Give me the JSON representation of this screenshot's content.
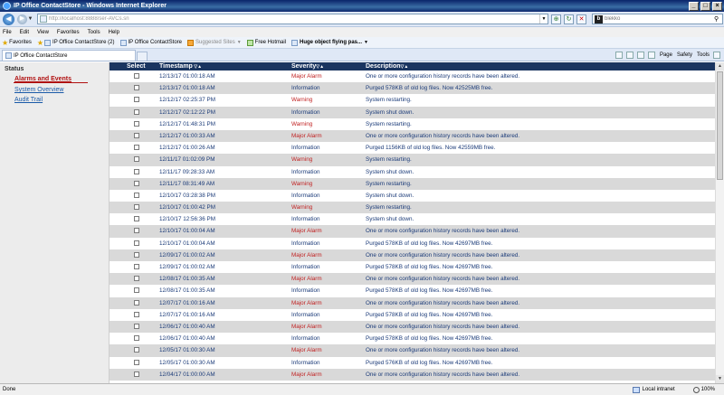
{
  "window": {
    "title": "IP Office ContactStore - Windows Internet Explorer"
  },
  "address": {
    "url": "http://localhost:8888/ser-AVCs.sn"
  },
  "search": {
    "placeholder": "blekko"
  },
  "menu": [
    "File",
    "Edit",
    "View",
    "Favorites",
    "Tools",
    "Help"
  ],
  "favorites": {
    "label": "Favorites",
    "items": [
      {
        "label": "IP Office ContactStore (2)",
        "icon": "page-icon"
      },
      {
        "label": "IP Office ContactStore",
        "icon": "page-icon"
      },
      {
        "label": "Suggested Sites",
        "icon": "rss-icon",
        "muted": true
      },
      {
        "label": "Free Hotmail",
        "icon": "page-icon"
      },
      {
        "label": "Huge object flying pas...",
        "icon": "page-icon",
        "bold": true
      }
    ]
  },
  "tab": {
    "label": "IP Office ContactStore"
  },
  "commandbar": {
    "page": "Page",
    "safety": "Safety",
    "tools": "Tools"
  },
  "sidebar": {
    "title": "Status",
    "items": [
      {
        "label": "Alarms and Events",
        "active": true
      },
      {
        "label": "System Overview",
        "active": false
      },
      {
        "label": "Audit Trail",
        "active": false
      }
    ]
  },
  "table": {
    "headers": {
      "select": "Select",
      "timestamp": "Timestamp",
      "severity": "Severity",
      "description": "Description"
    },
    "rows": [
      {
        "timestamp": "12/13/17 01:00:18 AM",
        "severity": "Major Alarm",
        "description": "One or more configuration history records have been altered."
      },
      {
        "timestamp": "12/13/17 01:00:18 AM",
        "severity": "Information",
        "description": "Purged 578KB of old log files. Now 42525MB free."
      },
      {
        "timestamp": "12/12/17 02:25:37 PM",
        "severity": "Warning",
        "description": "System restarting."
      },
      {
        "timestamp": "12/12/17 02:12:22 PM",
        "severity": "Information",
        "description": "System shut down."
      },
      {
        "timestamp": "12/12/17 01:48:31 PM",
        "severity": "Warning",
        "description": "System restarting."
      },
      {
        "timestamp": "12/12/17 01:00:33 AM",
        "severity": "Major Alarm",
        "description": "One or more configuration history records have been altered."
      },
      {
        "timestamp": "12/12/17 01:00:26 AM",
        "severity": "Information",
        "description": "Purged 1156KB of old log files. Now 42559MB free."
      },
      {
        "timestamp": "12/11/17 01:02:09 PM",
        "severity": "Warning",
        "description": "System restarting."
      },
      {
        "timestamp": "12/11/17 09:28:33 AM",
        "severity": "Information",
        "description": "System shut down."
      },
      {
        "timestamp": "12/11/17 08:31:49 AM",
        "severity": "Warning",
        "description": "System restarting."
      },
      {
        "timestamp": "12/10/17 03:28:38 PM",
        "severity": "Information",
        "description": "System shut down."
      },
      {
        "timestamp": "12/10/17 01:00:42 PM",
        "severity": "Warning",
        "description": "System restarting."
      },
      {
        "timestamp": "12/10/17 12:56:36 PM",
        "severity": "Information",
        "description": "System shut down."
      },
      {
        "timestamp": "12/10/17 01:00:04 AM",
        "severity": "Major Alarm",
        "description": "One or more configuration history records have been altered."
      },
      {
        "timestamp": "12/10/17 01:00:04 AM",
        "severity": "Information",
        "description": "Purged 578KB of old log files. Now 42697MB free."
      },
      {
        "timestamp": "12/09/17 01:00:02 AM",
        "severity": "Major Alarm",
        "description": "One or more configuration history records have been altered."
      },
      {
        "timestamp": "12/09/17 01:00:02 AM",
        "severity": "Information",
        "description": "Purged 578KB of old log files. Now 42697MB free."
      },
      {
        "timestamp": "12/08/17 01:00:35 AM",
        "severity": "Major Alarm",
        "description": "One or more configuration history records have been altered."
      },
      {
        "timestamp": "12/08/17 01:00:35 AM",
        "severity": "Information",
        "description": "Purged 578KB of old log files. Now 42697MB free."
      },
      {
        "timestamp": "12/07/17 01:00:16 AM",
        "severity": "Major Alarm",
        "description": "One or more configuration history records have been altered."
      },
      {
        "timestamp": "12/07/17 01:00:16 AM",
        "severity": "Information",
        "description": "Purged 578KB of old log files. Now 42697MB free."
      },
      {
        "timestamp": "12/06/17 01:00:40 AM",
        "severity": "Major Alarm",
        "description": "One or more configuration history records have been altered."
      },
      {
        "timestamp": "12/06/17 01:00:40 AM",
        "severity": "Information",
        "description": "Purged 578KB of old log files. Now 42697MB free."
      },
      {
        "timestamp": "12/05/17 01:00:30 AM",
        "severity": "Major Alarm",
        "description": "One or more configuration history records have been altered."
      },
      {
        "timestamp": "12/05/17 01:00:30 AM",
        "severity": "Information",
        "description": "Purged 576KB of old log files. Now 42697MB free."
      },
      {
        "timestamp": "12/04/17 01:00:00 AM",
        "severity": "Major Alarm",
        "description": "One or more configuration history records have been altered."
      }
    ]
  },
  "status": {
    "left": "Done",
    "zone": "Local intranet",
    "zoom": "100%"
  },
  "colors": {
    "header_bg": "#1a3560",
    "alarm_red": "#c02020",
    "link_blue": "#1a5aa8",
    "row_alt": "#d9d9d9"
  }
}
